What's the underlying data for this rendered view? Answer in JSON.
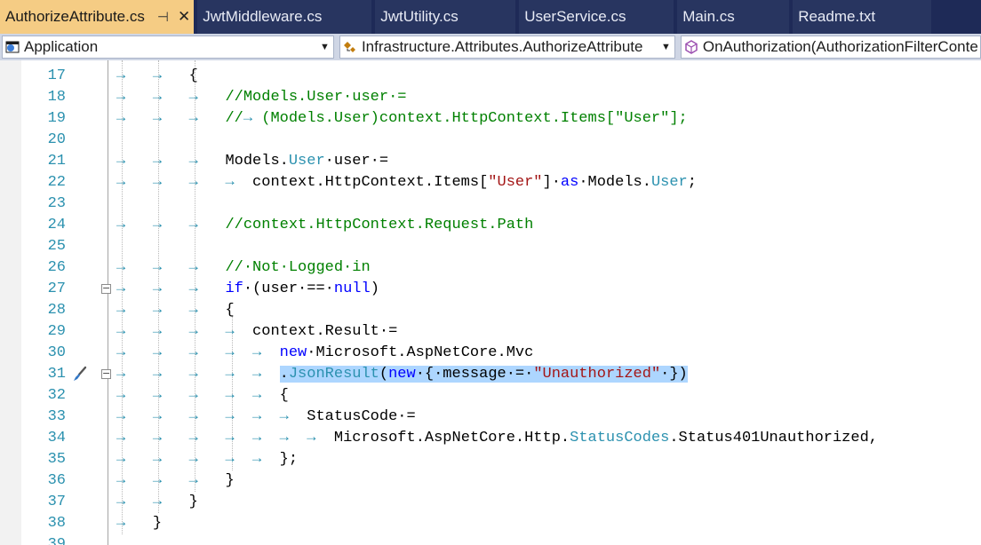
{
  "tabs": [
    {
      "label": "AuthorizeAttribute.cs",
      "active": true,
      "pin": "⊣",
      "close": "✕"
    },
    {
      "label": "JwtMiddleware.cs"
    },
    {
      "label": "JwtUtility.cs"
    },
    {
      "label": "UserService.cs"
    },
    {
      "label": "Main.cs"
    },
    {
      "label": "Readme.txt"
    }
  ],
  "navbar": {
    "project": "Application",
    "type": "Infrastructure.Attributes.AuthorizeAttribute",
    "member": "OnAuthorization(AuthorizationFilterConte"
  },
  "colors": {
    "comment": "#008000",
    "keyword": "#0000ff",
    "type": "#2b91af",
    "string": "#a31515",
    "selection": "#add6ff",
    "line_number": "#2b91af",
    "active_tab": "#f5cc84",
    "tab_strip": "#1e2a57"
  },
  "editor": {
    "lines": [
      {
        "n": "17",
        "tabs": 2,
        "tokens": [
          [
            "{",
            "tx"
          ]
        ]
      },
      {
        "n": "18",
        "tabs": 3,
        "tokens": [
          [
            "//Models.User·user·=",
            "cm"
          ]
        ]
      },
      {
        "n": "19",
        "tabs": 3,
        "tokens": [
          [
            "//",
            "cm"
          ],
          [
            "→ ",
            "ws"
          ],
          [
            "(Models.User)context.HttpContext.Items[\"User\"];",
            "cm"
          ]
        ]
      },
      {
        "n": "20",
        "tabs": 0,
        "tokens": []
      },
      {
        "n": "21",
        "tabs": 3,
        "tokens": [
          [
            "Models.",
            "tx"
          ],
          [
            "User",
            "ty"
          ],
          [
            "·user·=",
            "tx"
          ]
        ]
      },
      {
        "n": "22",
        "tabs": 3,
        "tokens": [
          [
            "→  ",
            "ws"
          ],
          [
            "context.HttpContext.Items[",
            "tx"
          ],
          [
            "\"User\"",
            "st"
          ],
          [
            "]·",
            "tx"
          ],
          [
            "as",
            "kw"
          ],
          [
            "·Models.",
            "tx"
          ],
          [
            "User",
            "ty"
          ],
          [
            ";",
            "tx"
          ]
        ]
      },
      {
        "n": "23",
        "tabs": 0,
        "tokens": []
      },
      {
        "n": "24",
        "tabs": 3,
        "tokens": [
          [
            "//context.HttpContext.Request.Path",
            "cm"
          ]
        ]
      },
      {
        "n": "25",
        "tabs": 0,
        "tokens": []
      },
      {
        "n": "26",
        "tabs": 3,
        "tokens": [
          [
            "//·Not·Logged·in",
            "cm"
          ]
        ]
      },
      {
        "n": "27",
        "tabs": 3,
        "fold": true,
        "tokens": [
          [
            "if",
            "kw"
          ],
          [
            "·(user·==·",
            "tx"
          ],
          [
            "null",
            "kw"
          ],
          [
            ")",
            "tx"
          ]
        ]
      },
      {
        "n": "28",
        "tabs": 3,
        "tokens": [
          [
            "{",
            "tx"
          ]
        ]
      },
      {
        "n": "29",
        "tabs": 3,
        "tokens": [
          [
            "→  ",
            "ws"
          ],
          [
            "context.Result·=",
            "tx"
          ]
        ]
      },
      {
        "n": "30",
        "tabs": 3,
        "tokens": [
          [
            "→  ",
            "ws"
          ],
          [
            "→  ",
            "ws"
          ],
          [
            "new",
            "kw"
          ],
          [
            "·Microsoft.AspNetCore.Mvc",
            "tx"
          ]
        ]
      },
      {
        "n": "31",
        "tabs": 3,
        "fold": true,
        "brush": true,
        "tokens": [
          [
            "→  ",
            "ws"
          ],
          [
            "→  ",
            "ws"
          ],
          [
            ".",
            "tx",
            "sel"
          ],
          [
            "JsonResult",
            "ty",
            "sel"
          ],
          [
            "(",
            "tx",
            "sel"
          ],
          [
            "new",
            "kw",
            "sel"
          ],
          [
            "·{·message·=·",
            "tx",
            "sel"
          ],
          [
            "\"Unauthorized\"",
            "st",
            "sel"
          ],
          [
            "·})",
            "tx",
            "sel"
          ]
        ]
      },
      {
        "n": "32",
        "tabs": 3,
        "tokens": [
          [
            "→  ",
            "ws"
          ],
          [
            "→  ",
            "ws"
          ],
          [
            "{",
            "tx"
          ]
        ]
      },
      {
        "n": "33",
        "tabs": 3,
        "tokens": [
          [
            "→  ",
            "ws"
          ],
          [
            "→  ",
            "ws"
          ],
          [
            "→  ",
            "ws"
          ],
          [
            "StatusCode·=",
            "tx"
          ]
        ]
      },
      {
        "n": "34",
        "tabs": 3,
        "tokens": [
          [
            "→  ",
            "ws"
          ],
          [
            "→  ",
            "ws"
          ],
          [
            "→  ",
            "ws"
          ],
          [
            "→  ",
            "ws"
          ],
          [
            "Microsoft.AspNetCore.Http.",
            "tx"
          ],
          [
            "StatusCodes",
            "ty"
          ],
          [
            ".Status401Unauthorized,",
            "tx"
          ]
        ]
      },
      {
        "n": "35",
        "tabs": 3,
        "tokens": [
          [
            "→  ",
            "ws"
          ],
          [
            "→  ",
            "ws"
          ],
          [
            "};",
            "tx"
          ]
        ]
      },
      {
        "n": "36",
        "tabs": 3,
        "tokens": [
          [
            "}",
            "tx"
          ]
        ]
      },
      {
        "n": "37",
        "tabs": 2,
        "tokens": [
          [
            "}",
            "tx"
          ]
        ]
      },
      {
        "n": "38",
        "tabs": 1,
        "tokens": [
          [
            "}",
            "tx"
          ]
        ]
      },
      {
        "n": "39",
        "tabs": 0,
        "tokens": []
      }
    ]
  }
}
